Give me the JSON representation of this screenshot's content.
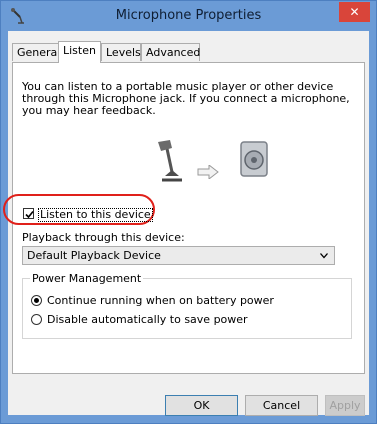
{
  "window": {
    "title": "Microphone Properties",
    "close_glyph": "✕"
  },
  "tabs": [
    {
      "label": "General"
    },
    {
      "label": "Listen"
    },
    {
      "label": "Levels"
    },
    {
      "label": "Advanced"
    }
  ],
  "listen": {
    "description": "You can listen to a portable music player or other device through this Microphone jack.  If you connect a microphone, you may hear feedback.",
    "listen_checkbox": {
      "label": "Listen to this device",
      "checked": true
    },
    "playback_label": "Playback through this device:",
    "playback_select": {
      "value": "Default Playback Device"
    },
    "power": {
      "legend": "Power Management",
      "options": [
        {
          "label": "Continue running when on battery power",
          "selected": true
        },
        {
          "label": "Disable automatically to save power",
          "selected": false
        }
      ]
    }
  },
  "buttons": {
    "ok": "OK",
    "cancel": "Cancel",
    "apply": "Apply"
  },
  "icons": {
    "app": "microphone-app-icon",
    "mic": "microphone-icon",
    "arrow": "right-arrow-icon",
    "speaker": "speaker-icon"
  },
  "colors": {
    "titlebar": "#6b9bd6",
    "close": "#d9453a",
    "highlight": "#e0201a"
  }
}
